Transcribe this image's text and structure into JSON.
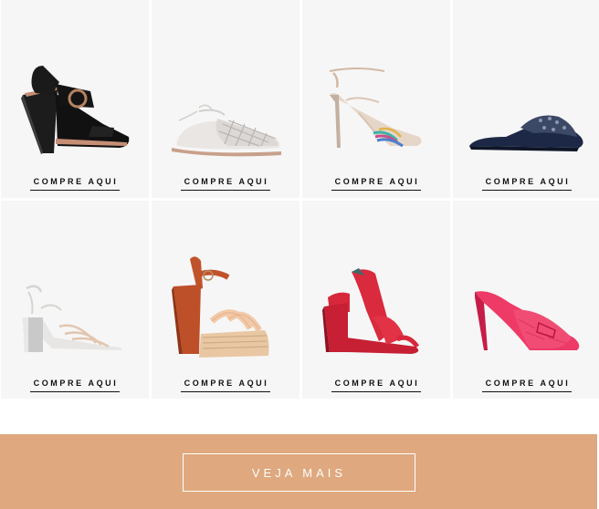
{
  "products": [
    {
      "cta": "COMPRE AQUI",
      "icon": "black-wedge-sandal-icon"
    },
    {
      "cta": "COMPRE AQUI",
      "icon": "white-woven-flat-sandal-icon"
    },
    {
      "cta": "COMPRE AQUI",
      "icon": "gold-strappy-heel-icon"
    },
    {
      "cta": "COMPRE AQUI",
      "icon": "navy-embellished-mule-icon"
    },
    {
      "cta": "COMPRE AQUI",
      "icon": "silver-block-heel-sandal-icon"
    },
    {
      "cta": "COMPRE AQUI",
      "icon": "tan-platform-sandal-icon"
    },
    {
      "cta": "COMPRE AQUI",
      "icon": "red-block-heel-sandal-icon"
    },
    {
      "cta": "COMPRE AQUI",
      "icon": "pink-croc-mule-icon"
    }
  ],
  "banner": {
    "button_label": "VEJA MAIS",
    "background": "#dfa87e"
  }
}
